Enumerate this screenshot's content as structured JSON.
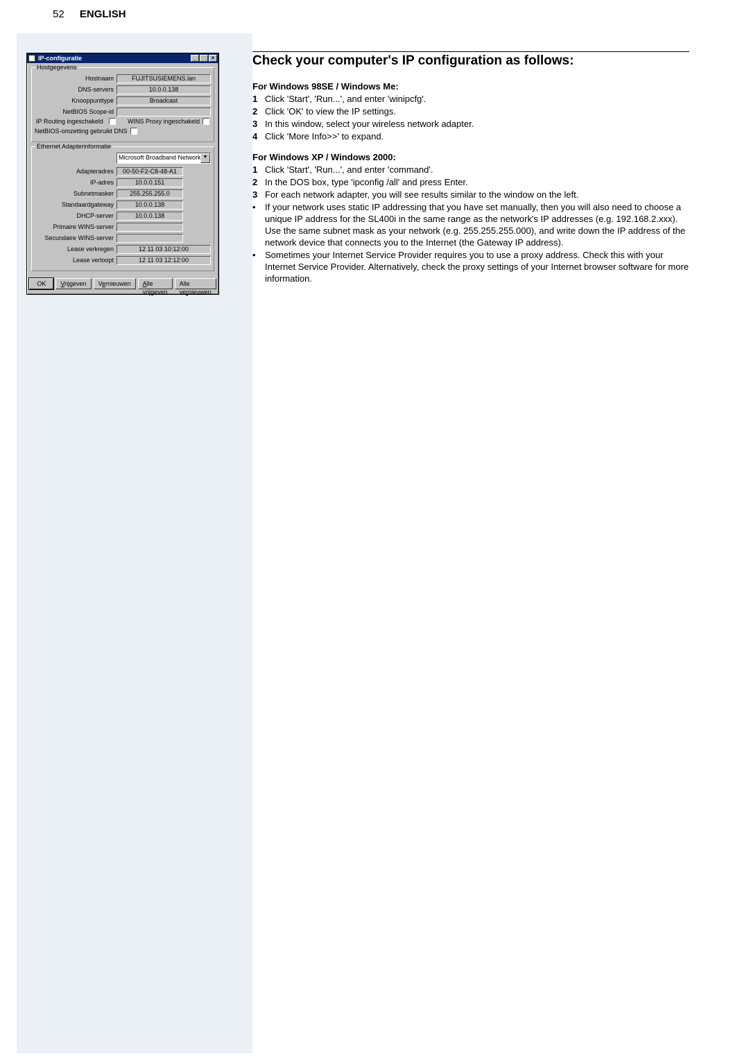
{
  "header": {
    "page": "52",
    "language": "ENGLISH"
  },
  "window": {
    "title": "IP-configuratie",
    "group1_label": "Hostgegevens",
    "fields1": {
      "hostnaam_label": "Hostnaam",
      "hostnaam_value": "FUJITSUSIEMENS.lan",
      "dns_label": "DNS-servers",
      "dns_value": "10.0.0.138",
      "knooppunt_label": "Knooppunttype",
      "knooppunt_value": "Broadcast",
      "netbios_scope_label": "NetBIOS Scope-id",
      "ip_routing_label": "IP Routing ingeschakeld",
      "wins_proxy_label": "WINS Proxy ingeschakeld",
      "netbios_dns_label": "NetBIOS-omzetting gebruikt DNS"
    },
    "group2_label": "Ethernet Adapterinformatie",
    "dropdown_value": "Microsoft Broadband Networking Wirele",
    "fields2": {
      "adapter_label": "Adapteradres",
      "adapter_value": "00-50-F2-C8-48-A1",
      "ip_label": "IP-adres",
      "ip_value": "10.0.0.151",
      "subnet_label": "Subnetmasker",
      "subnet_value": "255.255.255.0",
      "gateway_label": "Standaardgateway",
      "gateway_value": "10.0.0.138",
      "dhcp_label": "DHCP-server",
      "dhcp_value": "10.0.0.138",
      "primaire_label": "Primaire WINS-server",
      "secundaire_label": "Secundaire WINS-server",
      "lease_v_label": "Lease verkregen",
      "lease_v_value": "12 11 03 10:12:00",
      "lease_e_label": "Lease verloopt",
      "lease_e_value": "12 11 03 12:12:00"
    },
    "buttons": {
      "ok": "OK",
      "vrijgeven": "Vrijgeven",
      "vernieuwen": "Vernieuwen",
      "alle_vrijgeven": "Alle vrijgeven",
      "alle_vernieuwen": "Alle vernieuwen"
    }
  },
  "content": {
    "section_title": "Check your computer's IP configuration as follows:",
    "sub1": "For Windows 98SE / Windows Me:",
    "steps1": [
      "Click 'Start', 'Run...', and enter 'winipcfg'.",
      "Click 'OK' to view the IP settings.",
      "In this window, select your wireless network adapter.",
      "Click 'More Info>>' to expand."
    ],
    "sub2": "For Windows XP / Windows 2000:",
    "steps2": [
      "Click 'Start', 'Run...', and enter 'command'.",
      "In the DOS box, type 'ipconfig /all' and press Enter.",
      "For each network adapter, you will see results similar to the window on the left."
    ],
    "bullets": [
      "If your network uses static IP addressing that you have set manually, then you will also need to choose a unique IP address for the SL400i in the same range as the network's IP addresses (e.g. 192.168.2.xxx). Use the same subnet mask as your network (e.g. 255.255.255.000), and write down the IP address of the network device that connects you to the Internet (the Gateway IP address).",
      "Sometimes your Internet Service Provider requires you to use a proxy address. Check this with your Internet Service Provider. Alternatively, check the proxy settings of your Internet browser software for more information."
    ]
  }
}
